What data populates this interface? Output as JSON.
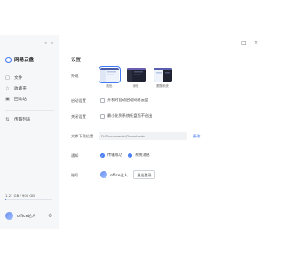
{
  "app": {
    "name": "网易云盘"
  },
  "sidebar": {
    "items": [
      {
        "label": "文件",
        "icon": "file-icon"
      },
      {
        "label": "收藏夹",
        "icon": "star-icon"
      },
      {
        "label": "回收站",
        "icon": "trash-icon"
      },
      {
        "label": "传输列表",
        "icon": "transfer-icon"
      }
    ],
    "quota": {
      "text": "1.21 GB / 900 GB",
      "used_fraction": 0.02
    },
    "user": {
      "name": "office达人"
    }
  },
  "settings": {
    "title": "设置",
    "appearance": {
      "label": "外观",
      "options": [
        {
          "label": "浅色",
          "selected": true
        },
        {
          "label": "深色",
          "selected": false
        },
        {
          "label": "跟随系统",
          "selected": false
        }
      ]
    },
    "startup": {
      "label": "启动设置",
      "option": "开机时自动启动网易云盘",
      "checked": false
    },
    "exit": {
      "label": "关闭设置",
      "option": "最小化到系统托盘而不退出",
      "checked": false
    },
    "download": {
      "label": "文件下载位置",
      "path": "D:\\Documents\\Downloads",
      "change_label": "更改"
    },
    "notify": {
      "label": "通知",
      "options": [
        {
          "label": "传输成功",
          "checked": true
        },
        {
          "label": "系统消息",
          "checked": true
        }
      ]
    },
    "account": {
      "label": "账号",
      "name": "office达人",
      "logout_label": "退出登录"
    }
  },
  "colors": {
    "accent": "#3f78f2",
    "sidebar_bg": "#f6f7f9"
  }
}
